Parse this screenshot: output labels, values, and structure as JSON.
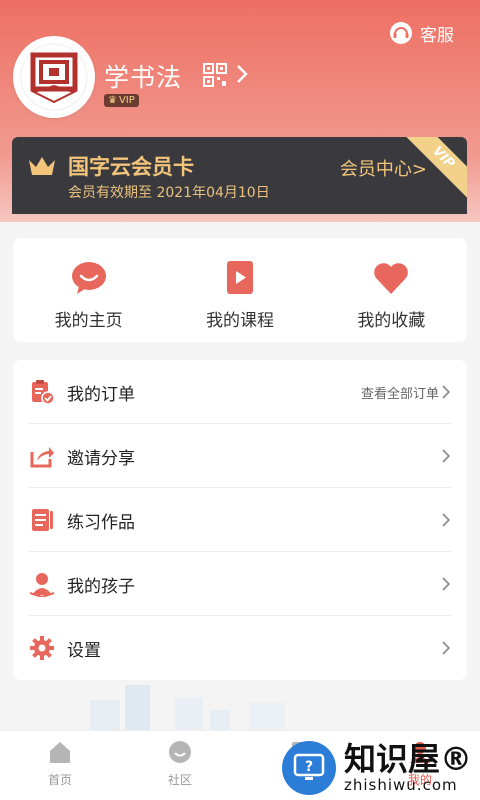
{
  "header": {
    "service_label": "客服",
    "username": "学书法",
    "vip_badge": "VIP"
  },
  "member_card": {
    "title": "国字云会员卡",
    "expiry": "会员有效期至 2021年04月10日",
    "center_link": "会员中心>",
    "corner_tag": "VIP"
  },
  "quick_actions": [
    {
      "label": "我的主页",
      "icon": "chat-bubble-icon"
    },
    {
      "label": "我的课程",
      "icon": "play-book-icon"
    },
    {
      "label": "我的收藏",
      "icon": "heart-icon"
    }
  ],
  "menu": [
    {
      "label": "我的订单",
      "icon": "clipboard-check-icon",
      "right_text": "查看全部订单"
    },
    {
      "label": "邀请分享",
      "icon": "share-icon",
      "right_text": ""
    },
    {
      "label": "练习作品",
      "icon": "notebook-icon",
      "right_text": ""
    },
    {
      "label": "我的孩子",
      "icon": "child-icon",
      "right_text": ""
    },
    {
      "label": "设置",
      "icon": "gear-icon",
      "right_text": ""
    }
  ],
  "tabbar": [
    {
      "label": "首页",
      "icon": "home-icon"
    },
    {
      "label": "社区",
      "icon": "community-icon"
    },
    {
      "label": "",
      "icon": "course-icon"
    },
    {
      "label": "我的",
      "icon": "profile-icon"
    }
  ],
  "watermark": {
    "cn": "知识屋®",
    "en": "zhishiwu.com"
  },
  "colors": {
    "primary": "#ee6f63",
    "card_bg": "#3a3a3e",
    "card_gold": "#f2c57a",
    "icon_red": "#e8675c"
  }
}
